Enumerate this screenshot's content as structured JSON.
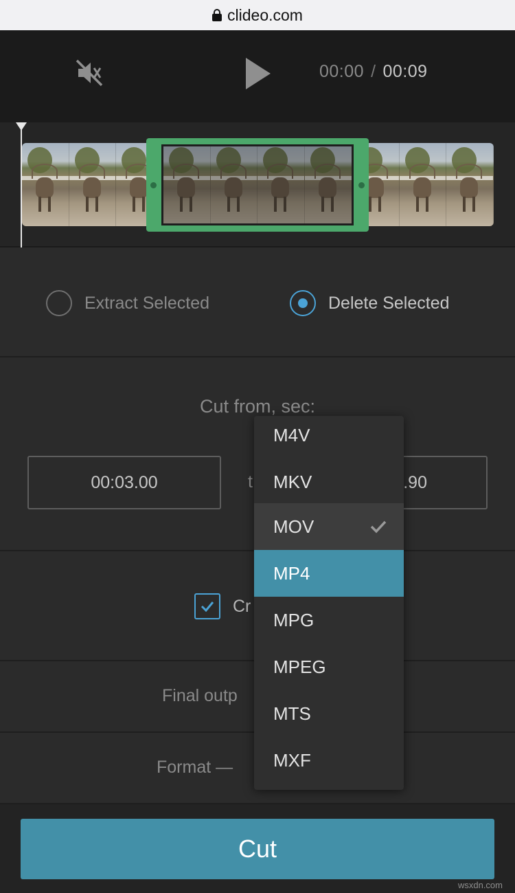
{
  "browser": {
    "url": "clideo.com"
  },
  "player": {
    "current_time": "00:00",
    "separator": "/",
    "total_time": "00:09"
  },
  "mode": {
    "extract_label": "Extract Selected",
    "delete_label": "Delete Selected",
    "selected": "delete"
  },
  "cut": {
    "title": "Cut from, sec:",
    "from_value": "00:03.00",
    "to_label": "t",
    "to_value": ".90"
  },
  "crossfade": {
    "label": "Cr",
    "checked": true
  },
  "final_output": {
    "label": "Final outp"
  },
  "format": {
    "label": "Format —"
  },
  "dropdown": {
    "options": [
      "M4V",
      "MKV",
      "MOV",
      "MP4",
      "MPG",
      "MPEG",
      "MTS",
      "MXF"
    ],
    "selected": "MOV",
    "highlighted": "MP4"
  },
  "action": {
    "cut_label": "Cut"
  },
  "watermark": "wsxdn.com",
  "colors": {
    "accent": "#4390a8",
    "selection": "#4ca86b",
    "radio": "#4ba3d6"
  }
}
